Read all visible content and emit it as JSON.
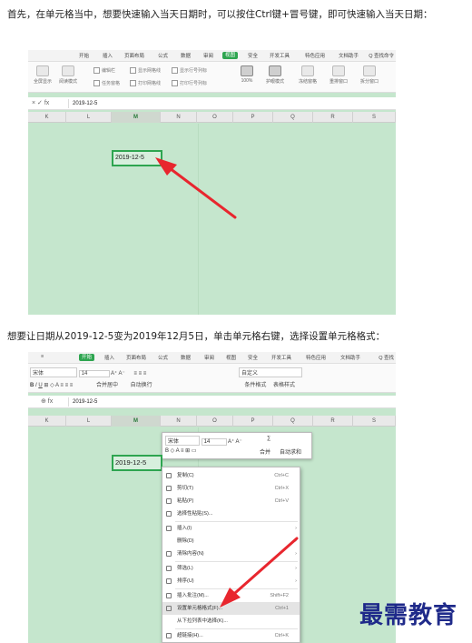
{
  "paragraphs": {
    "p1": "首先，在单元格当中，想要快速输入当天日期时，可以按住Ctrl键+冒号键，即可快速输入当天日期：",
    "p2": "想要让日期从2019-12-5变为2019年12月5日，单击单元格右键，选择设置单元格格式："
  },
  "shot1": {
    "tabs": [
      "开始",
      "插入",
      "页面布局",
      "公式",
      "数据",
      "审阅",
      "视图",
      "安全",
      "开发工具",
      "特色应用",
      "文档助手"
    ],
    "active_tab": "视图",
    "search": "Q 查找命令",
    "ribbon_buttons": [
      "全屏显示",
      "阅读模式",
      "100%",
      "护眼模式",
      "冻结窗格",
      "重排窗口",
      "拆分窗口"
    ],
    "checkboxes": [
      "编辑栏",
      "显示网格线",
      "显示行号列标",
      "任务窗格",
      "打印网格线",
      "打印行号列标"
    ],
    "formula_controls": "×  ✓  fx",
    "formula_value": "2019-12-5",
    "columns": [
      "K",
      "L",
      "M",
      "N",
      "O",
      "P",
      "Q",
      "R",
      "S"
    ],
    "selected_column": "M",
    "cell_value": "2019-12-5"
  },
  "shot2": {
    "tabs": [
      "开始",
      "插入",
      "页面布局",
      "公式",
      "数据",
      "审阅",
      "视图",
      "安全",
      "开发工具",
      "特色应用",
      "文档助手"
    ],
    "active_tab": "开始",
    "search": "Q 查找",
    "font_name": "宋体",
    "font_size": "14",
    "number_format": "自定义",
    "ribbon_labels": [
      "合并居中",
      "自动换行",
      "条件格式",
      "表格样式"
    ],
    "formula_controls": "⊕  fx",
    "formula_value": "2019-12-5",
    "columns": [
      "K",
      "L",
      "M",
      "N",
      "O",
      "P",
      "Q",
      "R",
      "S"
    ],
    "selected_column": "M",
    "cell_value": "2019-12-5",
    "mini_toolbar": {
      "font": "宋体",
      "size": "14",
      "row1_extra": "A⁺ A⁻",
      "merge": "合并",
      "autosum": "自动求和",
      "row2": "B ◇ A ≡ ⊞ ▭"
    },
    "context_menu": [
      {
        "label": "复制(C)",
        "shortcut": "Ctrl+C",
        "icon": "copy-icon"
      },
      {
        "label": "剪切(T)",
        "shortcut": "Ctrl+X",
        "icon": "cut-icon"
      },
      {
        "label": "粘贴(P)",
        "shortcut": "Ctrl+V",
        "icon": "paste-icon"
      },
      {
        "label": "选择性粘贴(S)...",
        "shortcut": "",
        "icon": "paste-special-icon"
      },
      {
        "label": "插入(I)",
        "shortcut": "",
        "icon": "insert-icon",
        "arrow": true
      },
      {
        "label": "删除(D)",
        "shortcut": "",
        "icon": "delete-icon",
        "arrow": true
      },
      {
        "label": "清除内容(N)",
        "shortcut": "",
        "icon": "eraser-icon",
        "arrow": true
      },
      {
        "label": "筛选(L)",
        "shortcut": "",
        "icon": "filter-icon",
        "arrow": true
      },
      {
        "label": "排序(U)",
        "shortcut": "",
        "icon": "sort-icon",
        "arrow": true
      },
      {
        "label": "插入批注(M)...",
        "shortcut": "Shift+F2",
        "icon": "comment-icon"
      },
      {
        "label": "设置单元格格式(F)...",
        "shortcut": "Ctrl+1",
        "icon": "format-cells-icon"
      },
      {
        "label": "从下拉列表中选择(K)...",
        "shortcut": "",
        "icon": ""
      },
      {
        "label": "超链接(H)...",
        "shortcut": "Ctrl+K",
        "icon": "link-icon"
      }
    ]
  },
  "watermark": "最需教育",
  "colors": {
    "accent": "#2ea550",
    "sheet_bg": "#c5e6cd",
    "arrow": "#e8262e",
    "watermark": "#1f2a8a"
  }
}
